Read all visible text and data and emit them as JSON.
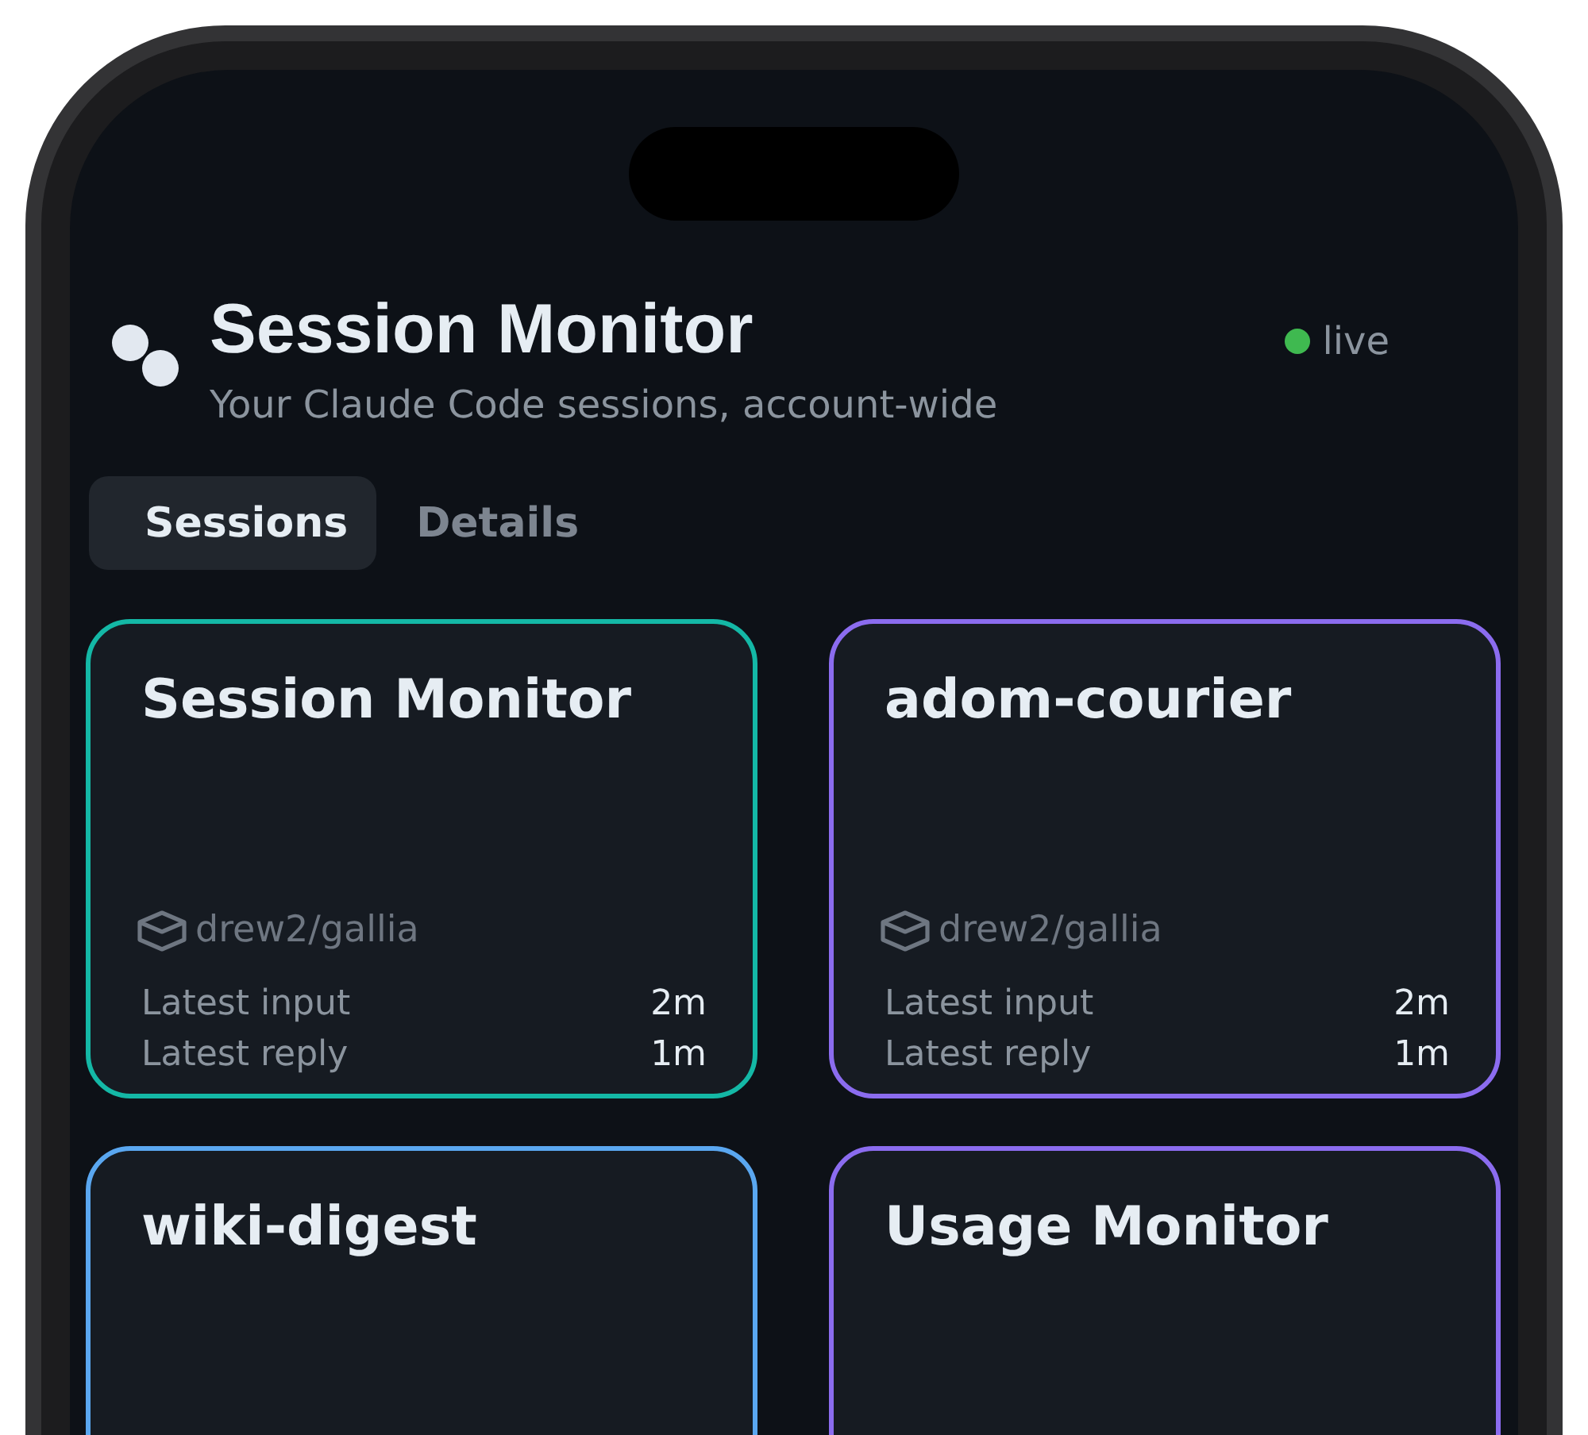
{
  "header": {
    "title": "Session Monitor",
    "subtitle": "Your Claude Code sessions, account-wide",
    "status": {
      "label": "live",
      "connected": true
    }
  },
  "tabs": [
    {
      "label": "Sessions",
      "selected": true
    },
    {
      "label": "Details",
      "selected": false
    }
  ],
  "sessions": [
    {
      "title": "Session Monitor",
      "color": "#14b8a6",
      "repo": "drew2/gallia",
      "stats": [
        {
          "label": "Latest input",
          "value": "2m"
        },
        {
          "label": "Latest reply",
          "value": "1m"
        }
      ]
    },
    {
      "title": "adom-courier",
      "color": "#8b6cef",
      "repo": "drew2/gallia",
      "stats": [
        {
          "label": "Latest input",
          "value": "2m"
        },
        {
          "label": "Latest reply",
          "value": "1m"
        }
      ]
    },
    {
      "title": "wiki-digest",
      "color": "#5aa7f0"
    },
    {
      "title": "Usage Monitor",
      "color": "#8b6cef"
    }
  ]
}
